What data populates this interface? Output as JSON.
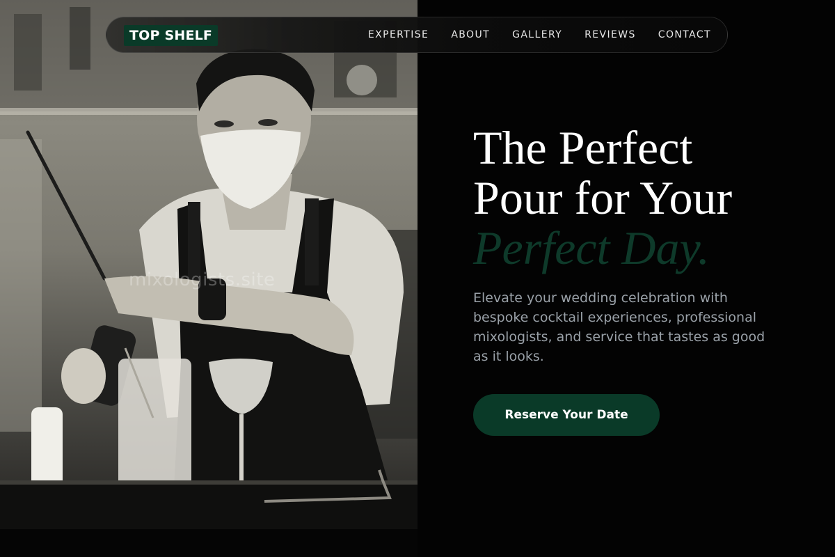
{
  "brand": {
    "logo_text": "TOP SHELF"
  },
  "nav": {
    "links": [
      {
        "label": "EXPERTISE"
      },
      {
        "label": "ABOUT"
      },
      {
        "label": "GALLERY"
      },
      {
        "label": "REVIEWS"
      },
      {
        "label": "CONTACT"
      }
    ]
  },
  "hero": {
    "title_line1": "The Perfect",
    "title_line2": "Pour for Your",
    "title_accent": "Perfect Day.",
    "subtitle": "Elevate your wedding celebration with bespoke cocktail experiences, professional mixologists, and service that tastes as good as it looks.",
    "cta_label": "Reserve Your Date"
  },
  "image": {
    "watermark": "mixologists.site"
  },
  "colors": {
    "accent_green": "#0a3a28",
    "accent_text": "#0e3a2a",
    "background": "#030303",
    "subtext": "#9aa1a8"
  }
}
